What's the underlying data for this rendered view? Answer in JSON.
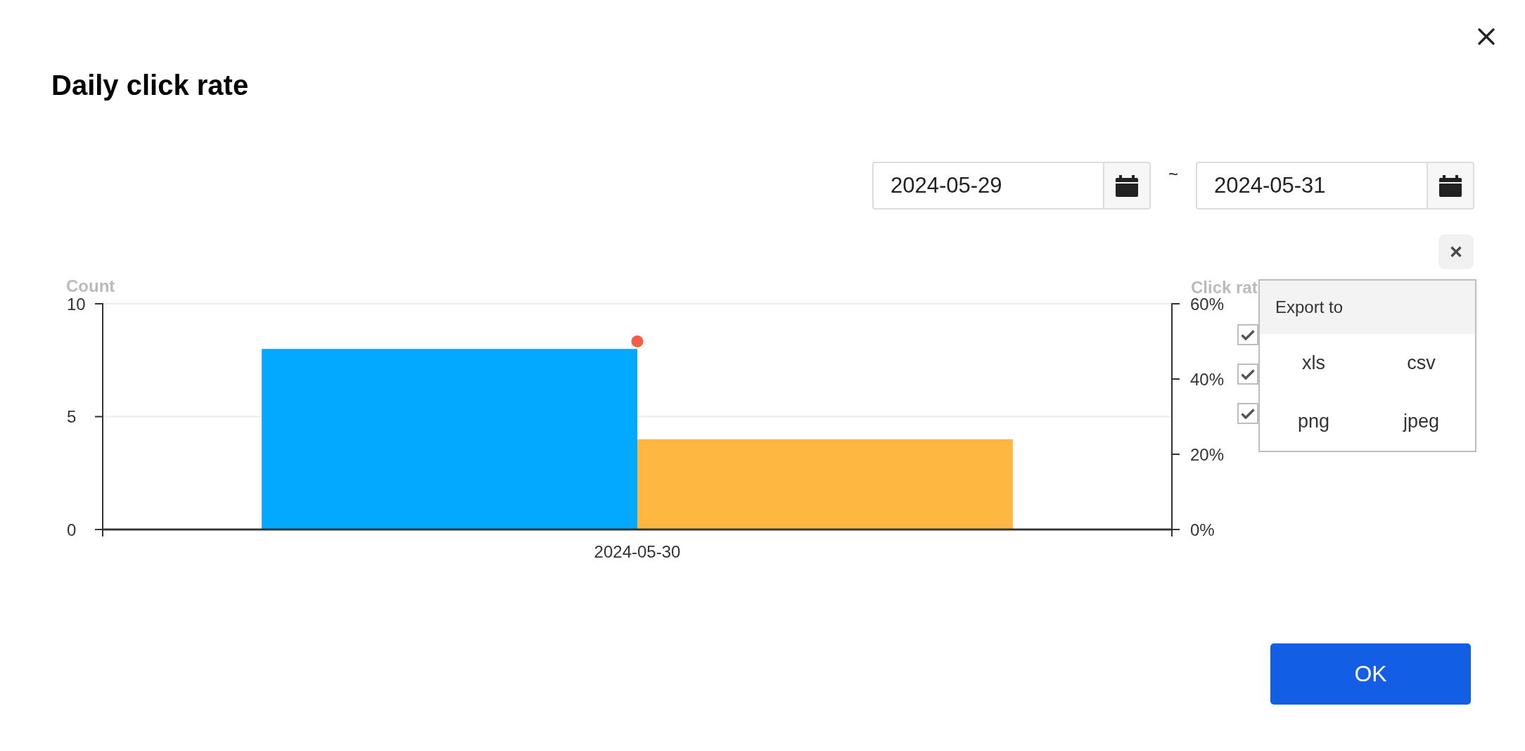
{
  "dialog": {
    "title": "Daily click rate"
  },
  "date_range": {
    "fields": [
      {
        "value": "2024-05-29"
      },
      {
        "value": "2024-05-31"
      }
    ],
    "separator": "~"
  },
  "chart": {
    "chart_data": {
      "type": "bar",
      "ylabel": "Count",
      "categories": [
        "2024-05-30"
      ],
      "ylim": [
        0,
        10
      ],
      "yticks": [
        0,
        5,
        10
      ],
      "series": [
        {
          "color": "#02a9ff",
          "values": [
            8
          ]
        },
        {
          "color": "#feb740",
          "values": [
            4
          ]
        }
      ]
    },
    "rate_overlay": {
      "chart_data": {
        "type": "line",
        "ylabel": "Click rat",
        "categories": [
          null
        ],
        "ylim": [
          0,
          60
        ],
        "yticks": [
          {
            "value": 0,
            "label": "0%"
          },
          {
            "value": 20,
            "label": "20%"
          },
          {
            "value": 40,
            "label": "40%"
          },
          {
            "value": 60,
            "label": "60%"
          }
        ],
        "series": [
          {
            "color": "#fa5a46",
            "marker": true,
            "values": [
              50
            ]
          }
        ]
      }
    },
    "legend": [
      {
        "checked": true
      },
      {
        "checked": true
      },
      {
        "checked": true
      }
    ],
    "export_menu": {
      "title": "Export to",
      "items": [
        "xls",
        "csv",
        "png",
        "jpeg"
      ]
    }
  },
  "ok_button": {
    "label": "OK"
  }
}
